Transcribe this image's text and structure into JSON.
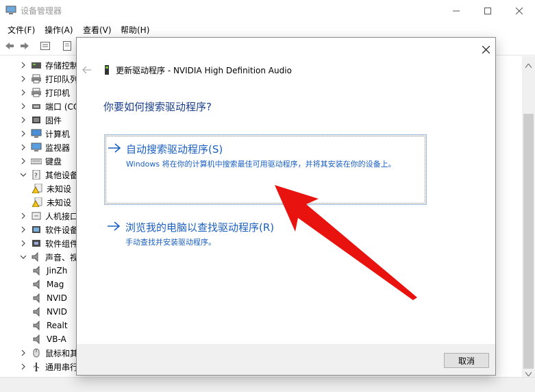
{
  "window": {
    "title": "设备管理器",
    "icon": "device-manager-icon"
  },
  "menu": [
    "文件(F)",
    "操作(A)",
    "查看(V)",
    "帮助(H)"
  ],
  "tree": [
    {
      "label": "存储控制",
      "expander": "collapsed",
      "icon": "storage-icon"
    },
    {
      "label": "打印队列",
      "expander": "collapsed",
      "icon": "printer-icon"
    },
    {
      "label": "打印机",
      "expander": "collapsed",
      "icon": "printer-icon"
    },
    {
      "label": "端口 (CO",
      "expander": "collapsed",
      "icon": "port-icon"
    },
    {
      "label": "固件",
      "expander": "collapsed",
      "icon": "firmware-icon"
    },
    {
      "label": "计算机",
      "expander": "collapsed",
      "icon": "computer-icon"
    },
    {
      "label": "监视器",
      "expander": "collapsed",
      "icon": "monitor-icon"
    },
    {
      "label": "键盘",
      "expander": "collapsed",
      "icon": "keyboard-icon"
    },
    {
      "label": "其他设备",
      "expander": "expanded",
      "icon": "unknown-device-icon"
    },
    {
      "label": "未知设",
      "expander": "none",
      "icon": "warning-device-icon",
      "child": true
    },
    {
      "label": "未知设",
      "expander": "none",
      "icon": "warning-device-icon",
      "child": true
    },
    {
      "label": "人机接口",
      "expander": "collapsed",
      "icon": "hid-icon"
    },
    {
      "label": "软件设备",
      "expander": "collapsed",
      "icon": "software-device-icon"
    },
    {
      "label": "软件组件",
      "expander": "collapsed",
      "icon": "software-component-icon"
    },
    {
      "label": "声音、视",
      "expander": "expanded",
      "icon": "speaker-icon"
    },
    {
      "label": "JinZh",
      "expander": "none",
      "icon": "speaker-icon",
      "child": true
    },
    {
      "label": "Mag",
      "expander": "none",
      "icon": "speaker-icon",
      "child": true
    },
    {
      "label": "NVID",
      "expander": "none",
      "icon": "speaker-icon",
      "child": true
    },
    {
      "label": "NVID",
      "expander": "none",
      "icon": "speaker-icon",
      "child": true
    },
    {
      "label": "Realt",
      "expander": "none",
      "icon": "speaker-icon",
      "child": true
    },
    {
      "label": "VB-A",
      "expander": "none",
      "icon": "speaker-icon",
      "child": true
    },
    {
      "label": "鼠标和其",
      "expander": "collapsed",
      "icon": "mouse-icon"
    },
    {
      "label": "通用串行",
      "expander": "collapsed",
      "icon": "usb-icon"
    }
  ],
  "dialog": {
    "title": "更新驱动程序 - NVIDIA High Definition Audio",
    "question": "你要如何搜索驱动程序?",
    "option_auto": {
      "title": "自动搜索驱动程序(S)",
      "description": "Windows 将在你的计算机中搜索最佳可用驱动程序，并将其安装在你的设备上。"
    },
    "option_browse": {
      "title": "浏览我的电脑以查找驱动程序(R)",
      "description": "手动查找并安装驱动程序。"
    },
    "cancel": "取消"
  },
  "colors": {
    "link_blue": "#1a5fc1",
    "heading_blue": "#1a3e8c",
    "annotation_red": "#e8130f"
  }
}
